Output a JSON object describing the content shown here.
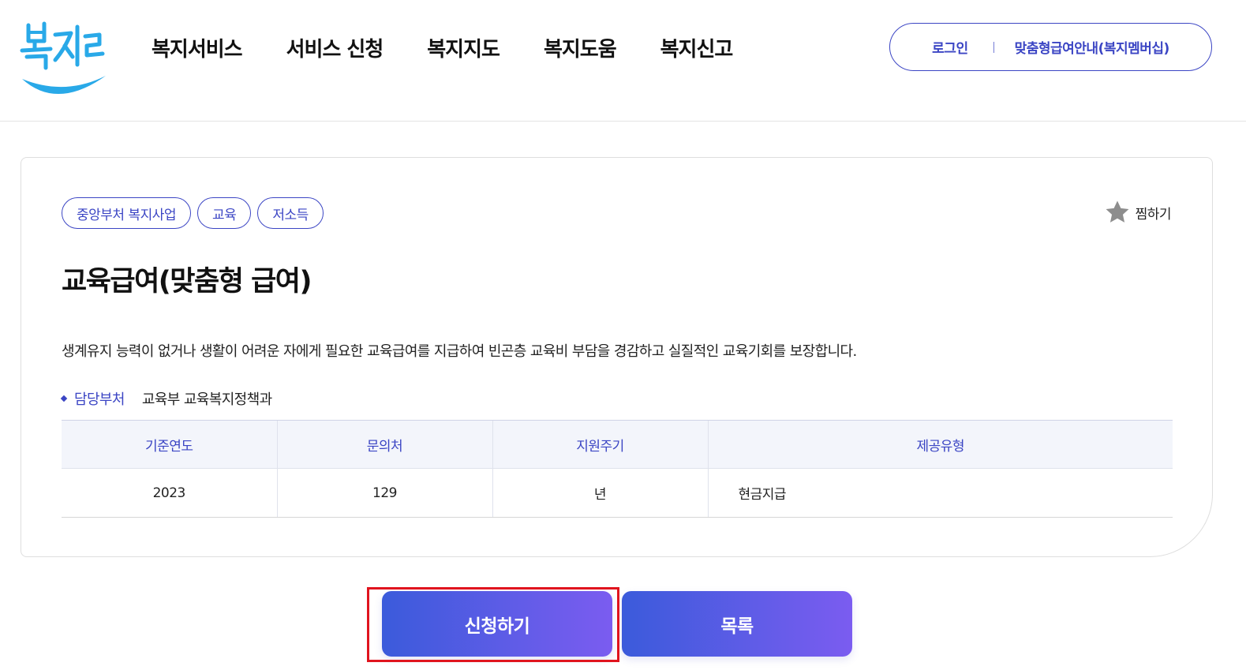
{
  "header": {
    "logo_text": "복지로",
    "nav": [
      "복지서비스",
      "서비스 신청",
      "복지지도",
      "복지도움",
      "복지신고"
    ],
    "util": {
      "login": "로그인",
      "membership": "맞춤형급여안내(복지멤버십)"
    }
  },
  "service": {
    "tags": [
      "중앙부처 복지사업",
      "교육",
      "저소득"
    ],
    "favorite_label": "찜하기",
    "title": "교육급여(맞춤형 급여)",
    "description": "생계유지 능력이 없거나 생활이 어려운 자에게 필요한 교육급여를 지급하여 빈곤층 교육비 부담을 경감하고 실질적인 교육기회를 보장합니다.",
    "dept_label": "담당부처",
    "dept_value": "교육부 교육복지정책과",
    "table": {
      "headers": [
        "기준연도",
        "문의처",
        "지원주기",
        "제공유형"
      ],
      "row": [
        "2023",
        "129",
        "년",
        "현금지급"
      ]
    }
  },
  "actions": {
    "apply_label": "신청하기",
    "list_label": "목록"
  },
  "colors": {
    "brand": "#3b45c4",
    "logo": "#29a9e8",
    "highlight": "#e0141e"
  }
}
